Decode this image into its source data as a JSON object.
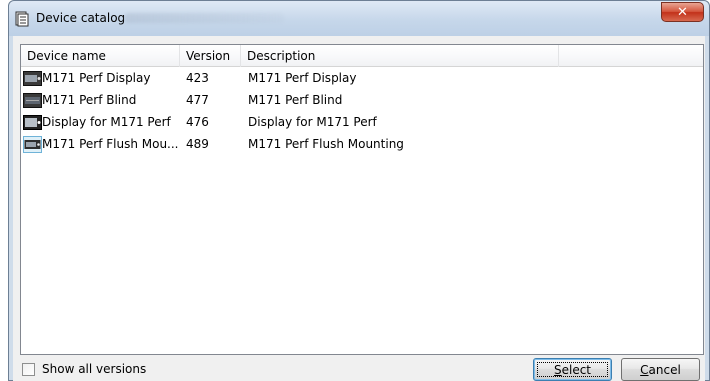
{
  "window": {
    "title": "Device catalog"
  },
  "columns": {
    "name": "Device name",
    "version": "Version",
    "description": "Description"
  },
  "devices": [
    {
      "name": "M171 Perf Display",
      "version": "423",
      "description": "M171 Perf Display",
      "icon": "device-display-icon"
    },
    {
      "name": "M171 Perf Blind",
      "version": "477",
      "description": "M171 Perf Blind",
      "icon": "device-blind-icon"
    },
    {
      "name": "Display for M171 Perf",
      "version": "476",
      "description": "Display for M171 Perf",
      "icon": "device-display-icon"
    },
    {
      "name": "M171 Perf Flush Mou...",
      "version": "489",
      "description": "M171 Perf Flush Mounting",
      "icon": "device-flush-icon"
    }
  ],
  "footer": {
    "show_all_versions_label": "Show all versions",
    "show_all_versions_checked": false,
    "select_label_u": "S",
    "select_label_rest": "elect",
    "cancel_label_u": "C",
    "cancel_label_rest": "ancel"
  },
  "colors": {
    "titlebar": "#c6d7ea",
    "close_button": "#c2311a",
    "select_border": "#3c7fb1"
  }
}
